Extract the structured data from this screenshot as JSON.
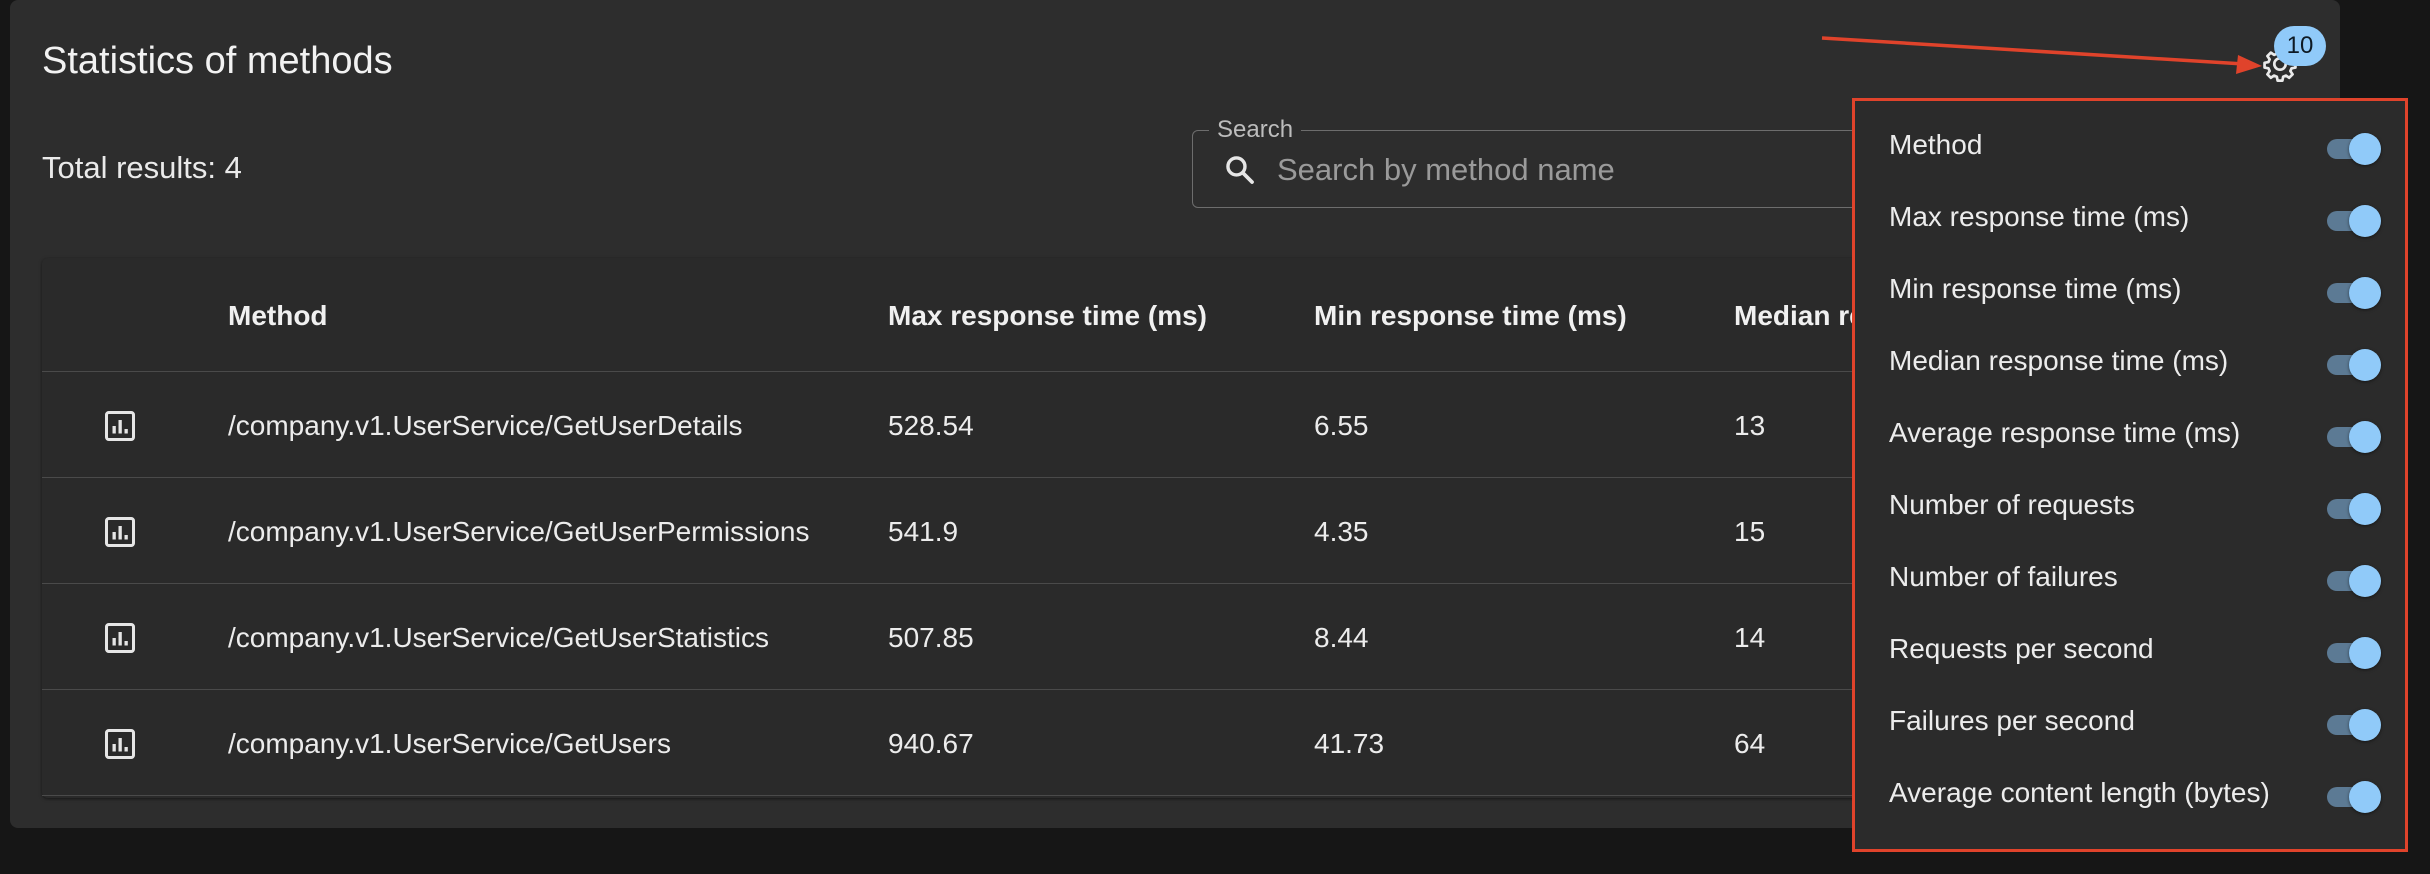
{
  "card": {
    "title": "Statistics of methods",
    "total_results": "Total results: 4"
  },
  "search": {
    "legend": "Search",
    "placeholder": "Search by method name",
    "value": ""
  },
  "table": {
    "headers": [
      "Method",
      "Max response time (ms)",
      "Min response time (ms)",
      "Median re"
    ],
    "rows": [
      {
        "method": "/company.v1.UserService/GetUserDetails",
        "max": "528.54",
        "min": "6.55",
        "median": "13"
      },
      {
        "method": "/company.v1.UserService/GetUserPermissions",
        "max": "541.9",
        "min": "4.35",
        "median": "15"
      },
      {
        "method": "/company.v1.UserService/GetUserStatistics",
        "max": "507.85",
        "min": "8.44",
        "median": "14"
      },
      {
        "method": "/company.v1.UserService/GetUsers",
        "max": "940.67",
        "min": "41.73",
        "median": "64"
      }
    ],
    "row_icon": "bar-chart-icon"
  },
  "settings": {
    "icon": "gear-icon",
    "badge_count": "10",
    "badge_color": "#90caf9",
    "highlight_color": "#e0432b",
    "columns": [
      {
        "label": "Method",
        "enabled": true
      },
      {
        "label": "Max response time (ms)",
        "enabled": true
      },
      {
        "label": "Min response time (ms)",
        "enabled": true
      },
      {
        "label": "Median response time (ms)",
        "enabled": true
      },
      {
        "label": "Average response time (ms)",
        "enabled": true
      },
      {
        "label": "Number of requests",
        "enabled": true
      },
      {
        "label": "Number of failures",
        "enabled": true
      },
      {
        "label": "Requests per second",
        "enabled": true
      },
      {
        "label": "Failures per second",
        "enabled": true
      },
      {
        "label": "Average content length (bytes)",
        "enabled": true
      }
    ]
  }
}
